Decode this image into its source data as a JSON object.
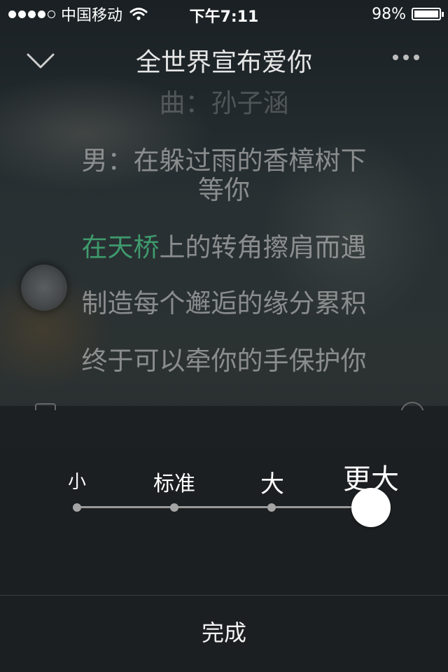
{
  "status_bar": {
    "carrier": "中国移动",
    "time": "下午7:11",
    "battery": "98%",
    "signal_bars_filled": 4,
    "signal_bars_total": 5
  },
  "header": {
    "title": "全世界宣布爱你",
    "back_icon": "chevron-down-icon",
    "more_icon": "more-dots-icon"
  },
  "lyrics": {
    "faded_top": "曲：孙子涵",
    "lines": [
      "男：在躲过雨的香樟树下",
      "等你",
      "上的转角擦肩而遇",
      "制造每个邂逅的缘分累积",
      "终于可以牵你的手保护你"
    ],
    "highlight_prefix": "在天桥",
    "highlight_color": "#3e9a6d"
  },
  "font_size": {
    "options": [
      "小",
      "标准",
      "大",
      "更大"
    ],
    "selected": "更大",
    "selected_index": 3
  },
  "done_label": "完成"
}
